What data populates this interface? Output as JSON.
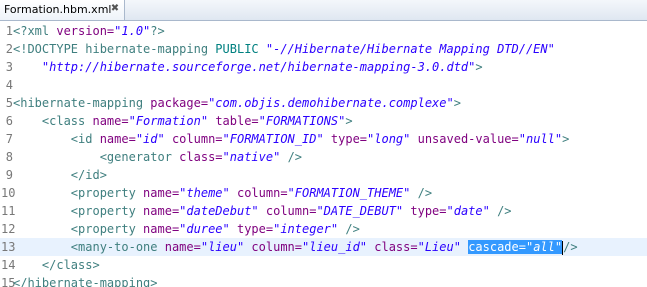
{
  "tab": {
    "title": "Formation.hbm.xml",
    "close_glyph": "✖"
  },
  "lines": [
    {
      "n": "1",
      "tokens": [
        {
          "t": "<?xml ",
          "c": "c-tag"
        },
        {
          "t": "version=",
          "c": "c-attr"
        },
        {
          "t": "\"1.0\"",
          "c": "c-val"
        },
        {
          "t": "?>",
          "c": "c-tag"
        }
      ]
    },
    {
      "n": "2",
      "tokens": [
        {
          "t": "<!DOCTYPE hibernate-mapping ",
          "c": "c-tag"
        },
        {
          "t": "PUBLIC ",
          "c": "c-dt"
        },
        {
          "t": "\"-//Hibernate/Hibernate Mapping DTD//EN\"",
          "c": "c-val"
        }
      ]
    },
    {
      "n": "3",
      "tokens": [
        {
          "t": "    \"http://hibernate.sourceforge.net/hibernate-mapping-3.0.dtd\"",
          "c": "c-val"
        },
        {
          "t": ">",
          "c": "c-tag"
        }
      ]
    },
    {
      "n": "4",
      "tokens": []
    },
    {
      "n": "5",
      "tokens": [
        {
          "t": "<hibernate-mapping ",
          "c": "c-tag"
        },
        {
          "t": "package=",
          "c": "c-attr"
        },
        {
          "t": "\"com.objis.demohibernate.complexe\"",
          "c": "c-val"
        },
        {
          "t": ">",
          "c": "c-tag"
        }
      ]
    },
    {
      "n": "6",
      "tokens": [
        {
          "t": "    <class ",
          "c": "c-tag"
        },
        {
          "t": "name=",
          "c": "c-attr"
        },
        {
          "t": "\"Formation\" ",
          "c": "c-val"
        },
        {
          "t": "table=",
          "c": "c-attr"
        },
        {
          "t": "\"FORMATIONS\"",
          "c": "c-val"
        },
        {
          "t": ">",
          "c": "c-tag"
        }
      ]
    },
    {
      "n": "7",
      "tokens": [
        {
          "t": "        <id ",
          "c": "c-tag"
        },
        {
          "t": "name=",
          "c": "c-attr"
        },
        {
          "t": "\"id\" ",
          "c": "c-val"
        },
        {
          "t": "column=",
          "c": "c-attr"
        },
        {
          "t": "\"FORMATION_ID\" ",
          "c": "c-val"
        },
        {
          "t": "type=",
          "c": "c-attr"
        },
        {
          "t": "\"long\" ",
          "c": "c-val"
        },
        {
          "t": "unsaved-value=",
          "c": "c-attr"
        },
        {
          "t": "\"null\"",
          "c": "c-val"
        },
        {
          "t": ">",
          "c": "c-tag"
        }
      ]
    },
    {
      "n": "8",
      "tokens": [
        {
          "t": "            <generator ",
          "c": "c-tag"
        },
        {
          "t": "class=",
          "c": "c-attr"
        },
        {
          "t": "\"native\" ",
          "c": "c-val"
        },
        {
          "t": "/>",
          "c": "c-tag"
        }
      ]
    },
    {
      "n": "9",
      "tokens": [
        {
          "t": "        </id>",
          "c": "c-tag"
        }
      ]
    },
    {
      "n": "10",
      "tokens": [
        {
          "t": "        <property ",
          "c": "c-tag"
        },
        {
          "t": "name=",
          "c": "c-attr"
        },
        {
          "t": "\"theme\" ",
          "c": "c-val"
        },
        {
          "t": "column=",
          "c": "c-attr"
        },
        {
          "t": "\"FORMATION_THEME\" ",
          "c": "c-val"
        },
        {
          "t": "/>",
          "c": "c-tag"
        }
      ]
    },
    {
      "n": "11",
      "tokens": [
        {
          "t": "        <property ",
          "c": "c-tag"
        },
        {
          "t": "name=",
          "c": "c-attr"
        },
        {
          "t": "\"dateDebut\" ",
          "c": "c-val"
        },
        {
          "t": "column=",
          "c": "c-attr"
        },
        {
          "t": "\"DATE_DEBUT\" ",
          "c": "c-val"
        },
        {
          "t": "type=",
          "c": "c-attr"
        },
        {
          "t": "\"date\" ",
          "c": "c-val"
        },
        {
          "t": "/>",
          "c": "c-tag"
        }
      ]
    },
    {
      "n": "12",
      "tokens": [
        {
          "t": "        <property ",
          "c": "c-tag"
        },
        {
          "t": "name=",
          "c": "c-attr"
        },
        {
          "t": "\"duree\" ",
          "c": "c-val"
        },
        {
          "t": "type=",
          "c": "c-attr"
        },
        {
          "t": "\"integer\" ",
          "c": "c-val"
        },
        {
          "t": "/>",
          "c": "c-tag"
        }
      ]
    },
    {
      "n": "13",
      "current": true,
      "tokens": [
        {
          "t": "        <many-to-one ",
          "c": "c-tag"
        },
        {
          "t": "name=",
          "c": "c-attr"
        },
        {
          "t": "\"lieu\" ",
          "c": "c-val"
        },
        {
          "t": "column=",
          "c": "c-attr"
        },
        {
          "t": "\"lieu_id\" ",
          "c": "c-val"
        },
        {
          "t": "class=",
          "c": "c-attr"
        },
        {
          "t": "\"Lieu\" ",
          "c": "c-val"
        },
        {
          "t": "cascade=",
          "c": "c-sel"
        },
        {
          "t": "\"all\"",
          "c": "c-selv"
        },
        {
          "caret": true
        },
        {
          "t": "/>",
          "c": "c-tag"
        }
      ]
    },
    {
      "n": "14",
      "tokens": [
        {
          "t": "    </class>",
          "c": "c-tag"
        }
      ]
    },
    {
      "n": "15",
      "tokens": [
        {
          "t": "</hibernate-mapping>",
          "c": "c-tag"
        }
      ]
    }
  ]
}
